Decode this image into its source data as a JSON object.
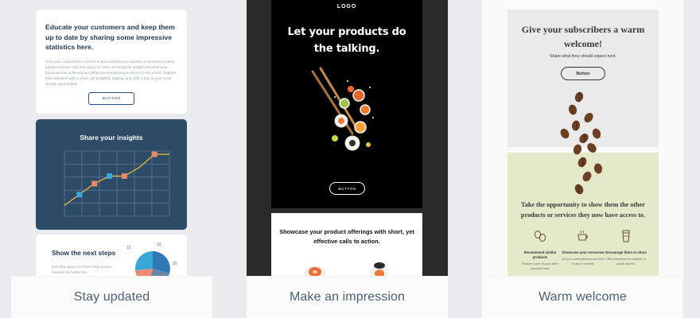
{
  "templates": [
    {
      "caption": "Stay updated",
      "card1": {
        "heading": "Educate your customers and keep them up to date by sharing some impressive statistics here.",
        "body": "Give your customers a chance to learn about your industry or business's latest advancements. Use this space to share an insightful insight into what your business has achieved and what you're planning to share in this email. Capture their attention with a short, yet insightful statistic and offer a link to your most recent report below.",
        "button": "BUTTON"
      },
      "card2": {
        "heading": "Share your insights",
        "line_values": [
          10,
          20,
          30,
          37,
          37,
          45,
          57,
          57
        ]
      },
      "card3": {
        "heading": "Show the next steps",
        "body": "Use this space to share what you've learned and what this",
        "pie_labels": [
          "15",
          "10",
          "30"
        ]
      }
    },
    {
      "caption": "Make an impression",
      "hero": {
        "logo": "LOGO",
        "title_line1": "Let your products do",
        "title_line2": "the talking.",
        "button": "BUTTON"
      },
      "card": {
        "heading": "Showcase your product offerings with short, yet effective calls to action."
      }
    },
    {
      "caption": "Warm welcome",
      "top": {
        "heading": "Give your subscribers a warm welcome!",
        "subheading": "Share what they should expect next.",
        "button": "Button"
      },
      "bottom": {
        "heading": "Take the opportunity to show them the other products or services they now have access to.",
        "features": [
          {
            "icon": "coffee-beans-icon",
            "label": "Recommend similar products",
            "desc": "Feature some of your other products here."
          },
          {
            "icon": "coffee-cup-icon",
            "label": "Showcase your resources",
            "desc": "Let your subscribers know there is help if needed."
          },
          {
            "icon": "takeaway-cup-icon",
            "label": "Encourage them to share",
            "desc": "Offer incentives for reviews or social shares."
          }
        ]
      }
    }
  ],
  "colors": {
    "navy": "#1f3556",
    "chart_bg": "#2d4b67",
    "chart_line": "#f2c030",
    "marker_orange": "#e8886b",
    "marker_blue": "#3aa7d8",
    "caption": "#4e5f74",
    "green_panel": "#e4e9c9"
  }
}
